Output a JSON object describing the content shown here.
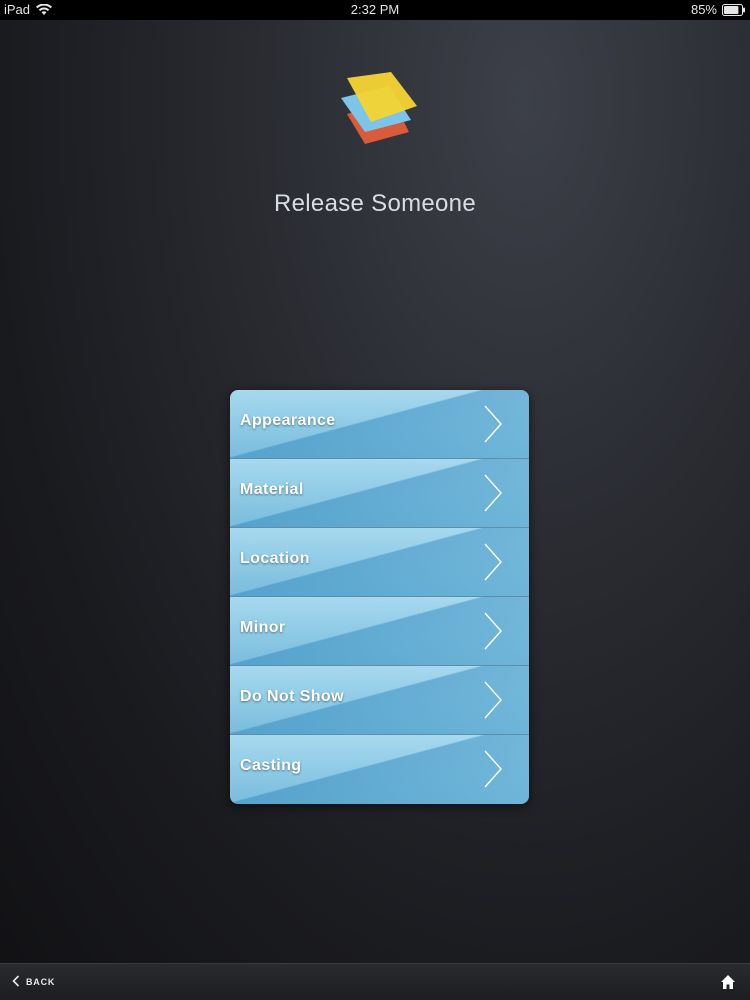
{
  "status_bar": {
    "device": "iPad",
    "time": "2:32 PM",
    "battery": "85%",
    "battery_level": 0.85
  },
  "header": {
    "title": "Release Someone",
    "logo_colors": [
      "#f2d333",
      "#7cc4e8",
      "#d85c3c"
    ]
  },
  "menu": {
    "items": [
      {
        "label": "Appearance"
      },
      {
        "label": "Material"
      },
      {
        "label": "Location"
      },
      {
        "label": "Minor"
      },
      {
        "label": "Do Not Show"
      },
      {
        "label": "Casting"
      }
    ]
  },
  "toolbar": {
    "back_label": "BACK",
    "back_icon": "chevron-left-icon",
    "home_icon": "home-icon"
  }
}
